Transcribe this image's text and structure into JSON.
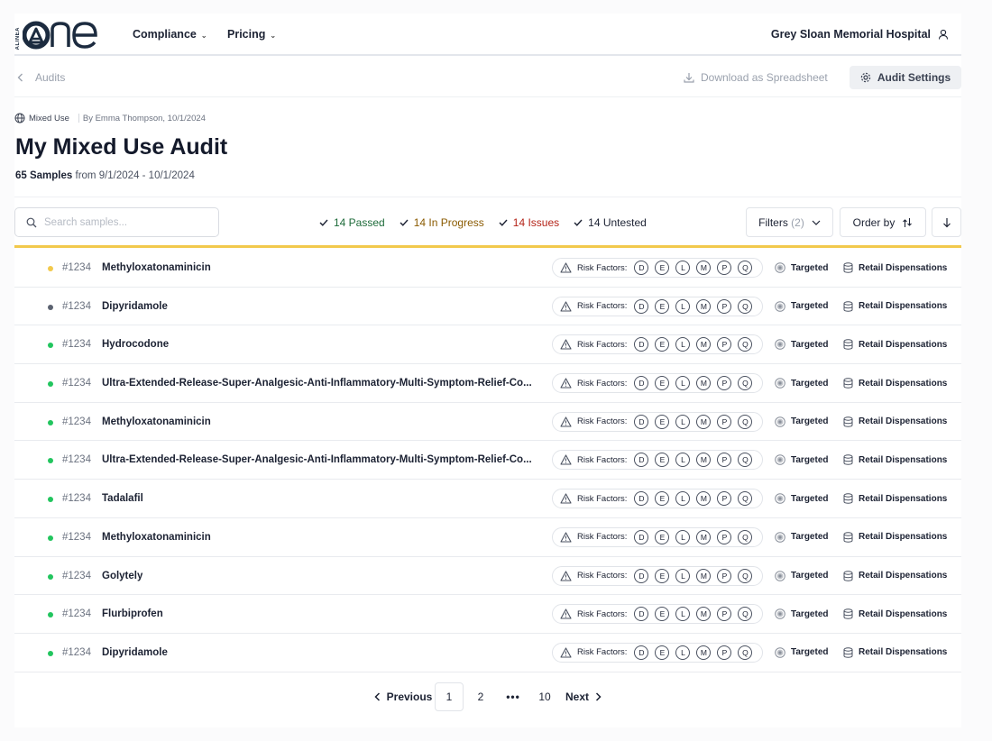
{
  "header": {
    "logo_small": "ALINEA",
    "logo_word": "one",
    "nav": [
      "Compliance",
      "Pricing"
    ],
    "hospital": "Grey Sloan Memorial Hospital"
  },
  "toolbar": {
    "back_label": "Audits",
    "download_label": "Download as Spreadsheet",
    "settings_label": "Audit Settings"
  },
  "audit": {
    "category": "Mixed Use",
    "byline": "By Emma Thompson, 10/1/2024",
    "title": "My Mixed Use Audit",
    "samples_count": "65 Samples",
    "date_range": "from 9/1/2024 - 10/1/2024"
  },
  "filter_bar": {
    "search_placeholder": "Search samples...",
    "statuses": [
      {
        "label": "14 Passed",
        "color": "#1e6b3a"
      },
      {
        "label": "14 In Progress",
        "color": "#8a5a00"
      },
      {
        "label": "14 Issues",
        "color": "#b42318"
      },
      {
        "label": "14 Untested",
        "color": "#1c2233"
      }
    ],
    "filters_label": "Filters",
    "filters_count": "(2)",
    "order_label": "Order by"
  },
  "progress_color": "#f2c94c",
  "row_labels": {
    "risk_label": "Risk Factors:",
    "risk_letters": [
      "D",
      "E",
      "L",
      "M",
      "P",
      "Q"
    ],
    "targeted": "Targeted",
    "retail": "Retail Dispensations"
  },
  "rows": [
    {
      "id": "#1234",
      "name": "Methyloxatonaminicin",
      "dot": "#f2c94c"
    },
    {
      "id": "#1234",
      "name": "Dipyridamole",
      "dot": "#5b6270"
    },
    {
      "id": "#1234",
      "name": "Hydrocodone",
      "dot": "#22c55e"
    },
    {
      "id": "#1234",
      "name": "Ultra-Extended-Release-Super-Analgesic-Anti-Inflammatory-Multi-Symptom-Relief-Co...",
      "dot": "#22c55e"
    },
    {
      "id": "#1234",
      "name": "Methyloxatonaminicin",
      "dot": "#22c55e"
    },
    {
      "id": "#1234",
      "name": "Ultra-Extended-Release-Super-Analgesic-Anti-Inflammatory-Multi-Symptom-Relief-Co...",
      "dot": "#22c55e"
    },
    {
      "id": "#1234",
      "name": "Tadalafil",
      "dot": "#22c55e"
    },
    {
      "id": "#1234",
      "name": "Methyloxatonaminicin",
      "dot": "#22c55e"
    },
    {
      "id": "#1234",
      "name": "Golytely",
      "dot": "#22c55e"
    },
    {
      "id": "#1234",
      "name": "Flurbiprofen",
      "dot": "#22c55e"
    },
    {
      "id": "#1234",
      "name": "Dipyridamole",
      "dot": "#22c55e"
    }
  ],
  "pagination": {
    "previous": "Previous",
    "pages": [
      "1",
      "2",
      "10"
    ],
    "ellipsis": "•••",
    "next": "Next"
  }
}
